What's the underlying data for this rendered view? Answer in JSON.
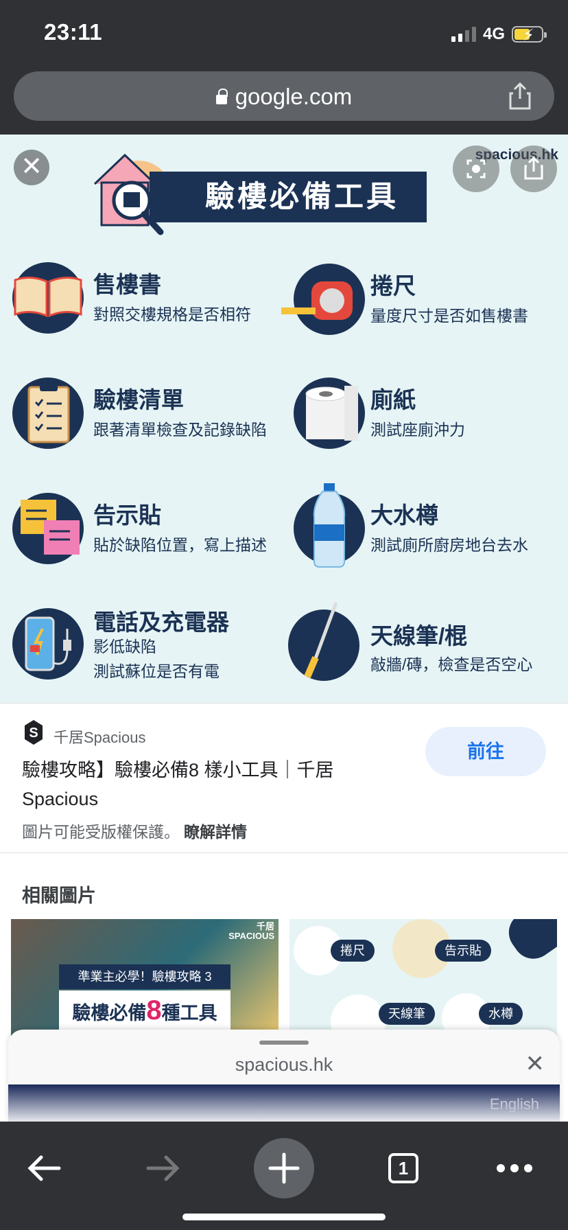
{
  "status_bar": {
    "time": "23:11",
    "network": "4G"
  },
  "address_bar": {
    "url": "google.com"
  },
  "image": {
    "watermark": "spacious.hk",
    "banner_title": "驗樓必備工具",
    "tools": [
      {
        "title": "售樓書",
        "desc": [
          "對照交樓規格是否相符"
        ]
      },
      {
        "title": "捲尺",
        "desc": [
          "量度尺寸是否如售樓書"
        ]
      },
      {
        "title": "驗樓清單",
        "desc": [
          "跟著清單檢查及記錄缺陷"
        ]
      },
      {
        "title": "廁紙",
        "desc": [
          "測試座廁沖力"
        ]
      },
      {
        "title": "告示貼",
        "desc": [
          "貼於缺陷位置，寫上描述"
        ]
      },
      {
        "title": "大水樽",
        "desc": [
          "測試廁所廚房地台去水"
        ]
      },
      {
        "title": "電話及充電器",
        "desc": [
          "影低缺陷",
          "測試蘇位是否有電"
        ]
      },
      {
        "title": "天線筆/棍",
        "desc": [
          "敲牆/磚，檢查是否空心"
        ]
      }
    ]
  },
  "result": {
    "source": "千居Spacious",
    "title": "驗樓攻略】驗樓必備8 樣小工具｜千居 Spacious",
    "visit_label": "前往",
    "copyright": "圖片可能受版權保護。",
    "learn_more": "瞭解詳情"
  },
  "related": {
    "title": "相關圖片",
    "thumb1": {
      "brand_line1": "千居",
      "brand_line2": "SPACIOUS",
      "tag": "準業主必學！驗樓攻略 3",
      "headline_a": "驗樓必備",
      "headline_num": "8",
      "headline_b": "種工具"
    },
    "thumb2": {
      "labels": [
        "捲尺",
        "告示貼",
        "天線筆",
        "水樽"
      ]
    }
  },
  "sheet": {
    "url": "spacious.hk",
    "lang": "English"
  },
  "toolbar": {
    "tab_count": "1"
  },
  "colors": {
    "navy": "#1b3254",
    "accent_blue": "#1a73e8",
    "image_bg": "#e6f4f5"
  }
}
